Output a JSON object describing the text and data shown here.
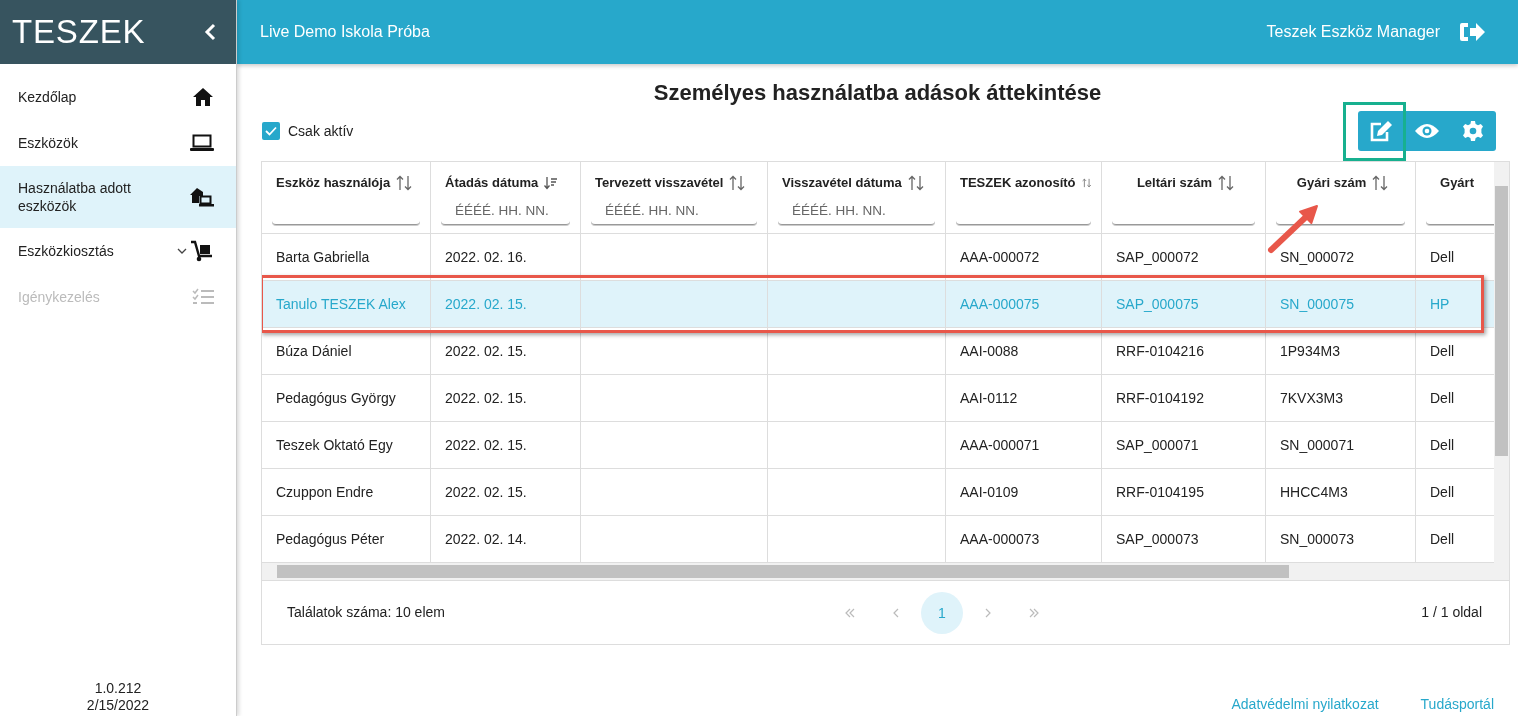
{
  "sidebar": {
    "logo": "TESZEK",
    "items": [
      {
        "label": "Kezdőlap",
        "selected": false,
        "disabled": false,
        "expandable": false
      },
      {
        "label": "Eszközök",
        "selected": false,
        "disabled": false,
        "expandable": false
      },
      {
        "label": "Használatba adott eszközök",
        "selected": true,
        "disabled": false,
        "expandable": false
      },
      {
        "label": "Eszközkiosztás",
        "selected": false,
        "disabled": false,
        "expandable": true
      },
      {
        "label": "Igénykezelés",
        "selected": false,
        "disabled": true,
        "expandable": false
      }
    ],
    "version": "1.0.212",
    "date": "2/15/2022"
  },
  "header": {
    "school": "Live Demo Iskola Próba",
    "app_name": "Teszek Eszköz Manager"
  },
  "page_title": "Személyes használatba adások áttekintése",
  "only_active": {
    "label": "Csak aktív",
    "checked": true
  },
  "toolbar": [
    {
      "kind": "edit",
      "highlighted": true
    },
    {
      "kind": "view",
      "highlighted": false
    },
    {
      "kind": "settings",
      "highlighted": false
    }
  ],
  "callout_arrow": true,
  "table": {
    "columns": [
      {
        "label": "Eszköz használója",
        "sorted": false,
        "kind": "text"
      },
      {
        "label": "Átadás dátuma",
        "sorted": true,
        "kind": "date",
        "placeholder": "ÉÉÉÉ. HH. NN."
      },
      {
        "label": "Tervezett visszavétel",
        "sorted": false,
        "kind": "date",
        "placeholder": "ÉÉÉÉ. HH. NN."
      },
      {
        "label": "Visszavétel dátuma",
        "sorted": false,
        "kind": "date",
        "placeholder": "ÉÉÉÉ. HH. NN."
      },
      {
        "label": "TESZEK azonosító",
        "sorted": false,
        "kind": "text"
      },
      {
        "label": "Leltári szám",
        "sorted": false,
        "kind": "text"
      },
      {
        "label": "Gyári szám",
        "sorted": false,
        "kind": "text"
      },
      {
        "label": "Gyárt",
        "kind": "text"
      }
    ],
    "rows": [
      {
        "selected": false,
        "highlighted": false,
        "cells": [
          "Barta Gabriella",
          "2022. 02. 16.",
          "",
          "",
          "AAA-000072",
          "SAP_000072",
          "SN_000072",
          "Dell"
        ]
      },
      {
        "selected": true,
        "highlighted": true,
        "cells": [
          "Tanulo TESZEK Alex",
          "2022. 02. 15.",
          "",
          "",
          "AAA-000075",
          "SAP_000075",
          "SN_000075",
          "HP"
        ]
      },
      {
        "selected": false,
        "highlighted": false,
        "cells": [
          "Búza Dániel",
          "2022. 02. 15.",
          "",
          "",
          "AAI-0088",
          "RRF-0104216",
          "1P934M3",
          "Dell"
        ]
      },
      {
        "selected": false,
        "highlighted": false,
        "cells": [
          "Pedagógus György",
          "2022. 02. 15.",
          "",
          "",
          "AAI-0112",
          "RRF-0104192",
          "7KVX3M3",
          "Dell"
        ]
      },
      {
        "selected": false,
        "highlighted": false,
        "cells": [
          "Teszek Oktató Egy",
          "2022. 02. 15.",
          "",
          "",
          "AAA-000071",
          "SAP_000071",
          "SN_000071",
          "Dell"
        ]
      },
      {
        "selected": false,
        "highlighted": false,
        "cells": [
          "Czuppon Endre",
          "2022. 02. 15.",
          "",
          "",
          "AAI-0109",
          "RRF-0104195",
          "HHCC4M3",
          "Dell"
        ]
      },
      {
        "selected": false,
        "highlighted": false,
        "cells": [
          "Pedagógus Péter",
          "2022. 02. 14.",
          "",
          "",
          "AAA-000073",
          "SAP_000073",
          "SN_000073",
          "Dell"
        ]
      }
    ]
  },
  "pagination": {
    "total": "Találatok száma: 10 elem",
    "pages": [
      {
        "label": "1",
        "selected": true
      }
    ],
    "summary": "1 / 1 oldal"
  },
  "footer_links": [
    "Adatvédelmi nyilatkozat",
    "Tudásportál"
  ]
}
